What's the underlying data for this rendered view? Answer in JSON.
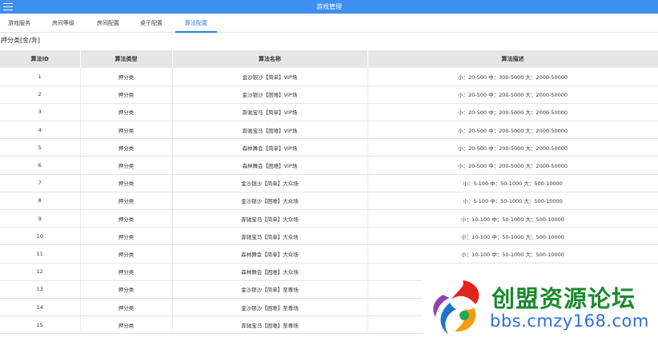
{
  "header": {
    "title": "游戏管理"
  },
  "tabs": [
    {
      "label": "游戏服务",
      "active": false
    },
    {
      "label": "房间等级",
      "active": false
    },
    {
      "label": "房间配置",
      "active": false
    },
    {
      "label": "桌子配置",
      "active": false
    },
    {
      "label": "算法配置",
      "active": true
    }
  ],
  "section": {
    "title": "押分类[金/奔]"
  },
  "table": {
    "columns": [
      "算法ID",
      "算法类型",
      "算法名称",
      "算法描述"
    ],
    "rows": [
      [
        "1",
        "押分类",
        "金沙银沙【简单】VIP场",
        "小：20-500 中：300-5000 大：2000-50000"
      ],
      [
        "2",
        "押分类",
        "金沙银沙【困难】VIP场",
        "小：20-500 中：200-5000 大：2000-50000"
      ],
      [
        "3",
        "押分类",
        "奔驰宝马【简单】VIP场",
        "小：20-500 中：200-5000 大：2000-50000"
      ],
      [
        "4",
        "押分类",
        "奔驰宝马【困难】VIP场",
        "小：20-500 中：200-5000 大：2000-50000"
      ],
      [
        "5",
        "押分类",
        "森林舞会【简单】VIP场",
        "小：20-500 中：200-5000 大：2000-50000"
      ],
      [
        "6",
        "押分类",
        "森林舞会【困难】VIP场",
        "小：20-500 中：200-5000 大：2000-50000"
      ],
      [
        "7",
        "押分类",
        "金沙银沙【简单】大众场",
        "小：5-100 中：50-1000 大：500-10000"
      ],
      [
        "8",
        "押分类",
        "金沙银沙【困难】大众场",
        "小：5-100 中：50-1000 大：500-10000"
      ],
      [
        "9",
        "押分类",
        "奔驰宝马【简单】大众场",
        "小：10-100 中：50-1000 大：500-10000"
      ],
      [
        "10",
        "押分类",
        "奔驰宝马【简单】大众场",
        "小：10-100 中：50-1000 大：500-10000"
      ],
      [
        "11",
        "押分类",
        "森林舞会【简单】大众场",
        "小：10-100 中：50-1000 大：500-10000"
      ],
      [
        "12",
        "押分类",
        "森林舞会【困难】大众场",
        ""
      ],
      [
        "13",
        "押分类",
        "金沙银沙【简单】至尊场",
        ""
      ],
      [
        "14",
        "押分类",
        "金沙银沙【困难】至尊场",
        ""
      ],
      [
        "15",
        "押分类",
        "奔驰宝马【困难】至尊场",
        ""
      ]
    ]
  },
  "watermark": {
    "name": "创盟资源论坛",
    "url": "bbs.cmzy168.com"
  },
  "colors": {
    "topbar": "#3d8ff0",
    "active_tab": "#2a7fde",
    "header_row": "#e6e6e6",
    "watermark_green": "#1a8a2e",
    "watermark_blue": "#2f6fd6"
  },
  "icons": {
    "menu": "hamburger-menu-icon",
    "logo": "swirl-logo-icon"
  }
}
